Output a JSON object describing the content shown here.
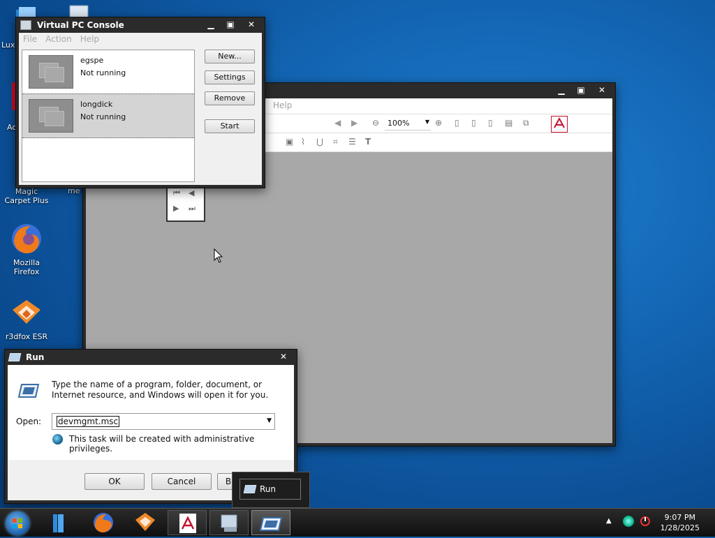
{
  "desktop": {
    "icons": [
      {
        "label": "Magic Carpet Plus"
      },
      {
        "label": "Mozilla Firefox"
      },
      {
        "label": "r3dfox ESR"
      }
    ],
    "partial_labels": [
      "Lux",
      "Ac",
      "me"
    ]
  },
  "vpc_console": {
    "title": "Virtual PC Console",
    "menu": [
      "File",
      "Action",
      "Help"
    ],
    "vms": [
      {
        "name": "egspe",
        "status": "Not running"
      },
      {
        "name": "longdick",
        "status": "Not running"
      }
    ],
    "buttons": {
      "new": "New...",
      "settings": "Settings",
      "remove": "Remove",
      "start": "Start"
    }
  },
  "acrobat": {
    "menu_help": "Help",
    "zoom": "100%",
    "icon_label": "Acrobat"
  },
  "run_dialog": {
    "title": "Run",
    "description": "Type the name of a program, folder, document, or Internet resource, and Windows will open it for you.",
    "open_label": "Open:",
    "open_value": "devmgmt.msc",
    "admin_note": "This task will be created with administrative privileges.",
    "ok": "OK",
    "cancel": "Cancel",
    "browse_partial": "B"
  },
  "tooltip": {
    "label": "Run"
  },
  "taskbar": {
    "time": "9:07 PM",
    "date": "1/28/2025"
  },
  "colors": {
    "desktop_blue": "#1366b4",
    "window_frame": "#2b2b2b",
    "accent_red": "#c8102e"
  }
}
